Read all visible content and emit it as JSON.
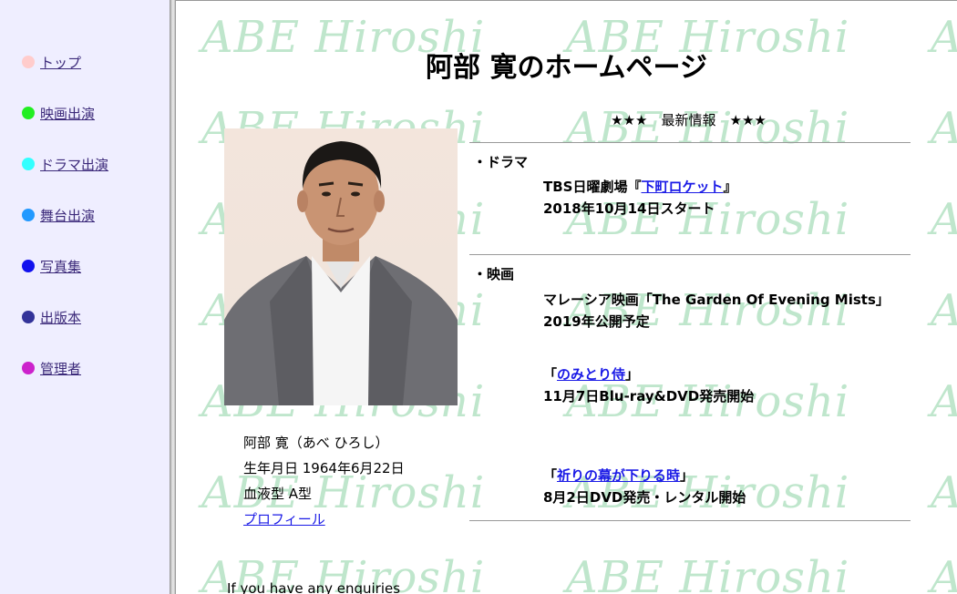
{
  "sidebar": {
    "items": [
      {
        "label": "トップ",
        "color": "#ffcccc"
      },
      {
        "label": "映画出演",
        "color": "#22ee22"
      },
      {
        "label": "ドラマ出演",
        "color": "#33ffff"
      },
      {
        "label": "舞台出演",
        "color": "#2299ff"
      },
      {
        "label": "写真集",
        "color": "#1111ee"
      },
      {
        "label": "出版本",
        "color": "#333399"
      },
      {
        "label": "管理者",
        "color": "#cc22cc"
      }
    ]
  },
  "watermark": "ABE Hiroshi",
  "title": "阿部 寛のホームページ",
  "news_heading": "★★★　最新情報　★★★",
  "profile": {
    "name": "阿部 寛（あべ ひろし）",
    "birthday": "生年月日 1964年6月22日",
    "blood": "血液型 A型",
    "link": "プロフィール"
  },
  "news": {
    "drama": {
      "category": "・ドラマ",
      "pre": "TBS日曜劇場『",
      "link": "下町ロケット",
      "post": "』",
      "detail": "2018年10月14日スタート"
    },
    "movie": {
      "category": "・映画",
      "item1_line1": "マレーシア映画「The Garden Of Evening Mists」",
      "item1_line2": "2019年公開予定",
      "item2_pre": "「",
      "item2_link": "のみとり侍",
      "item2_post": "」",
      "item2_detail": "11月7日Blu-ray&DVD発売開始",
      "item3_pre": "「",
      "item3_link": "祈りの幕が下りる時",
      "item3_post": "」",
      "item3_detail": "8月2日DVD発売・レンタル開始"
    }
  },
  "footer": {
    "enquiry": "If you have any enquiries"
  }
}
